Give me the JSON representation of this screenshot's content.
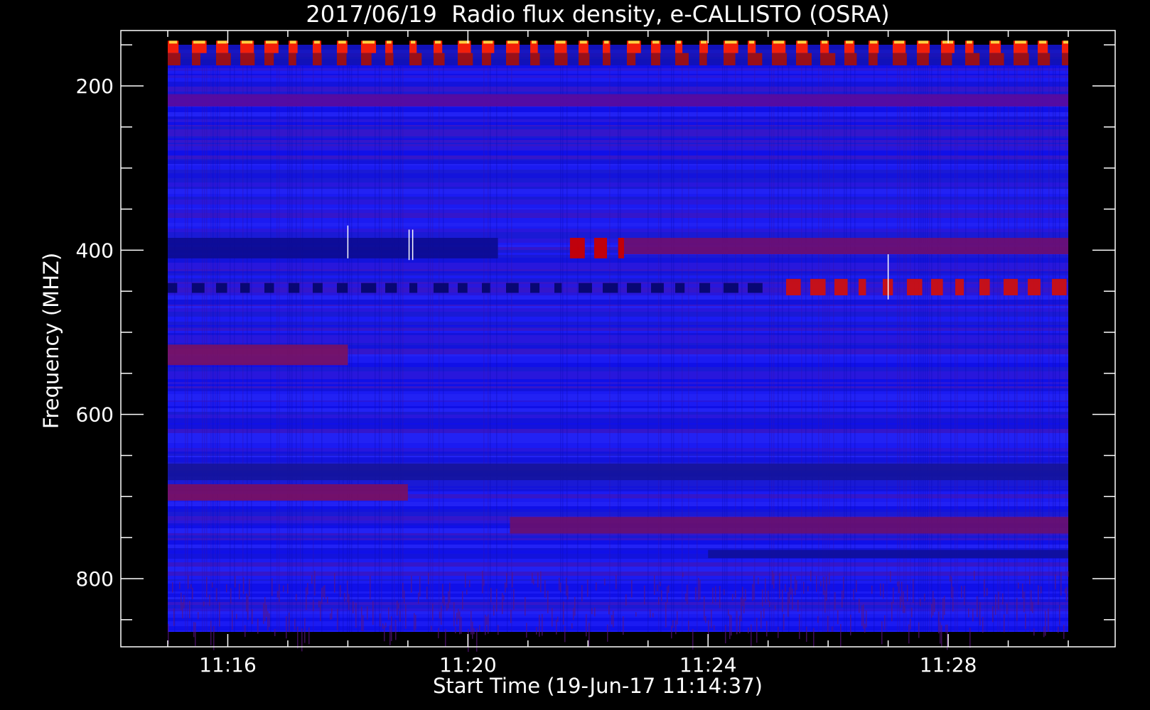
{
  "chart_data": {
    "type": "heatmap",
    "title": "2017/06/19  Radio flux density, e-CALLISTO (OSRA)",
    "xlabel": "Start Time (19-Jun-17 11:14:37)",
    "ylabel": "Frequency (MHZ)",
    "x_start": "11:14:37",
    "x_tick_labels": [
      "11:16",
      "11:20",
      "11:24",
      "11:28"
    ],
    "y_tick_labels": [
      "200",
      "400",
      "600",
      "800"
    ],
    "ylim": [
      150,
      880
    ],
    "y_reversed": true,
    "data_range_x": [
      "11:15:00",
      "11:30:00"
    ],
    "data_range_y_mhz": [
      145,
      870
    ],
    "colormap": [
      "#000000",
      "#0000ff",
      "#8b0000",
      "#ff0000",
      "#ff8000",
      "#ffff00"
    ],
    "bands": [
      {
        "fmin": 145,
        "fmax": 160,
        "tmin": 0,
        "tmax": 15,
        "pattern": "bursts",
        "color": "#ff2000"
      },
      {
        "fmin": 160,
        "fmax": 175,
        "tmin": 0,
        "tmax": 15,
        "pattern": "bursts",
        "color": "#a01010"
      },
      {
        "fmin": 210,
        "fmax": 225,
        "tmin": 0,
        "tmax": 15,
        "pattern": "solid",
        "color": "#5a0a9c"
      },
      {
        "fmin": 385,
        "fmax": 410,
        "tmin": 0,
        "tmax": 5.5,
        "pattern": "solid",
        "color": "#0b0b90"
      },
      {
        "fmin": 385,
        "fmax": 405,
        "tmin": 7.5,
        "tmax": 15,
        "pattern": "solid",
        "color": "#6e0e6e"
      },
      {
        "fmin": 385,
        "fmax": 410,
        "tmin": 6.7,
        "tmax": 7.6,
        "pattern": "bursts",
        "color": "#c80000"
      },
      {
        "fmin": 435,
        "fmax": 455,
        "tmin": 10.3,
        "tmax": 15,
        "pattern": "bursts",
        "color": "#cc1010"
      },
      {
        "fmin": 440,
        "fmax": 452,
        "tmin": 0,
        "tmax": 10,
        "pattern": "bursts",
        "color": "#06066e"
      },
      {
        "fmin": 515,
        "fmax": 540,
        "tmin": 0,
        "tmax": 3,
        "pattern": "solid",
        "color": "#7a1260"
      },
      {
        "fmin": 660,
        "fmax": 680,
        "tmin": 0,
        "tmax": 15,
        "pattern": "solid",
        "color": "#14149a"
      },
      {
        "fmin": 685,
        "fmax": 705,
        "tmin": 0,
        "tmax": 4,
        "pattern": "solid",
        "color": "#7a1060"
      },
      {
        "fmin": 725,
        "fmax": 745,
        "tmin": 5.7,
        "tmax": 15,
        "pattern": "solid",
        "color": "#6a106c"
      },
      {
        "fmin": 765,
        "fmax": 775,
        "tmin": 9,
        "tmax": 15,
        "pattern": "solid",
        "color": "#10109a"
      },
      {
        "fmin": 790,
        "fmax": 870,
        "tmin": 0,
        "tmax": 15,
        "pattern": "speckle",
        "color": "#5a1480"
      }
    ]
  }
}
